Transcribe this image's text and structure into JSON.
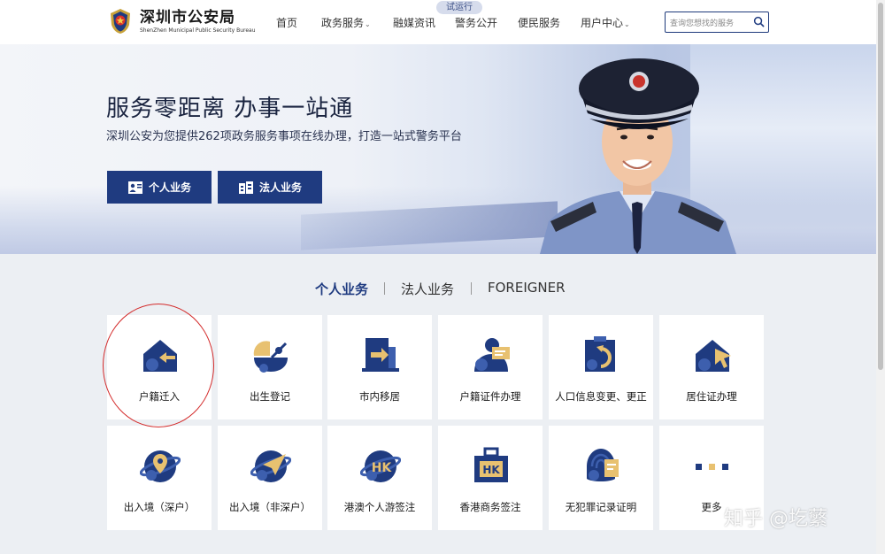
{
  "header": {
    "logo_cn": "深圳市公安局",
    "logo_en": "ShenZhen Municipal Public Security Bureau",
    "beta_badge": "试运行",
    "nav": [
      {
        "label": "首页",
        "has_dropdown": false
      },
      {
        "label": "政务服务",
        "has_dropdown": true
      },
      {
        "label": "融媒资讯",
        "has_dropdown": false
      },
      {
        "label": "警务公开",
        "has_dropdown": false
      },
      {
        "label": "便民服务",
        "has_dropdown": false
      },
      {
        "label": "用户中心",
        "has_dropdown": true
      }
    ],
    "search_placeholder": "查询您想找的服务"
  },
  "banner": {
    "title": "服务零距离 办事一站通",
    "subtitle": "深圳公安为您提供262项政务服务事项在线办理，打造一站式警务平台",
    "btn_personal": "个人业务",
    "btn_legal": "法人业务"
  },
  "tabs": [
    {
      "label": "个人业务",
      "active": true
    },
    {
      "label": "法人业务",
      "active": false
    },
    {
      "label": "FOREIGNER",
      "active": false
    }
  ],
  "services": [
    {
      "label": "户籍迁入",
      "icon": "house-arrow-icon"
    },
    {
      "label": "出生登记",
      "icon": "cradle-icon"
    },
    {
      "label": "市内移居",
      "icon": "move-arrow-icon"
    },
    {
      "label": "户籍证件办理",
      "icon": "person-card-icon"
    },
    {
      "label": "人口信息变更、更正",
      "icon": "info-change-icon"
    },
    {
      "label": "居住证办理",
      "icon": "house-cursor-icon"
    },
    {
      "label": "出入境（深户）",
      "icon": "globe-pin-icon"
    },
    {
      "label": "出入境（非深户）",
      "icon": "globe-plane-icon"
    },
    {
      "label": "港澳个人游签注",
      "icon": "globe-hk-icon"
    },
    {
      "label": "香港商务签注",
      "icon": "briefcase-hk-icon"
    },
    {
      "label": "无犯罪记录证明",
      "icon": "fingerprint-doc-icon"
    },
    {
      "label": "更多",
      "icon": "more-dots-icon"
    }
  ],
  "watermark": "知乎 @圪蘩",
  "colors": {
    "primary": "#1f3b80",
    "accent": "#e8c170",
    "highlight_circle": "#d32a2a"
  }
}
